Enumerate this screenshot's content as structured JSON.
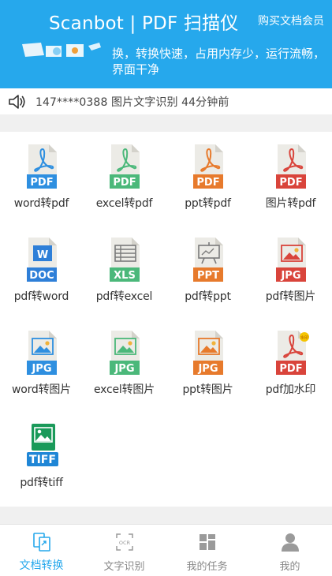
{
  "header": {
    "title": "Scanbot | PDF 扫描仪",
    "member_link": "购买文档会员",
    "banner_text": "换，转换快速，占用内存少，运行流畅，界面干净"
  },
  "notice": {
    "icon": "speaker-icon",
    "text": "147****0388 图片文字识别 44分钟前"
  },
  "tools": [
    {
      "label": "word转pdf",
      "icon": "pdf-file-icon",
      "badge": "PDF",
      "color": "#2e8fe0",
      "glyph": "acrobat"
    },
    {
      "label": "excel转pdf",
      "icon": "pdf-file-icon",
      "badge": "PDF",
      "color": "#4bb87a",
      "glyph": "acrobat"
    },
    {
      "label": "ppt转pdf",
      "icon": "pdf-file-icon",
      "badge": "PDF",
      "color": "#e77a2c",
      "glyph": "acrobat"
    },
    {
      "label": "图片转pdf",
      "icon": "pdf-file-icon",
      "badge": "PDF",
      "color": "#d9443b",
      "glyph": "acrobat"
    },
    {
      "label": "pdf转word",
      "icon": "doc-file-icon",
      "badge": "DOC",
      "color": "#2e7fd8",
      "glyph": "word"
    },
    {
      "label": "pdf转excel",
      "icon": "xls-file-icon",
      "badge": "XLS",
      "color": "#4bb87a",
      "glyph": "table"
    },
    {
      "label": "pdf转ppt",
      "icon": "ppt-file-icon",
      "badge": "PPT",
      "color": "#e77a2c",
      "glyph": "easel"
    },
    {
      "label": "pdf转图片",
      "icon": "jpg-file-icon",
      "badge": "JPG",
      "color": "#d9443b",
      "glyph": "image"
    },
    {
      "label": "word转图片",
      "icon": "jpg-file-icon",
      "badge": "JPG",
      "color": "#2e8fe0",
      "glyph": "image"
    },
    {
      "label": "excel转图片",
      "icon": "jpg-file-icon",
      "badge": "JPG",
      "color": "#4bb87a",
      "glyph": "image"
    },
    {
      "label": "ppt转图片",
      "icon": "jpg-file-icon",
      "badge": "JPG",
      "color": "#e77a2c",
      "glyph": "image"
    },
    {
      "label": "pdf加水印",
      "icon": "watermark-pdf-icon",
      "badge": "PDF",
      "color": "#d9443b",
      "glyph": "acrobat",
      "watermark": true,
      "watermark_text": "水印"
    },
    {
      "label": "pdf转tiff",
      "icon": "tiff-file-icon",
      "badge": "TIFF",
      "color": "#1f86d6",
      "glyph": "tiff"
    }
  ],
  "bottom_nav": [
    {
      "label": "文档转换",
      "icon": "document-convert-icon",
      "active": true
    },
    {
      "label": "文字识别",
      "icon": "ocr-icon",
      "active": false,
      "icon_text": "OCR"
    },
    {
      "label": "我的任务",
      "icon": "tasks-grid-icon",
      "active": false
    },
    {
      "label": "我的",
      "icon": "profile-icon",
      "active": false
    }
  ],
  "colors": {
    "accent": "#26a8ec",
    "nav_inactive": "#888888",
    "section_gap": "#f0f0f0"
  }
}
